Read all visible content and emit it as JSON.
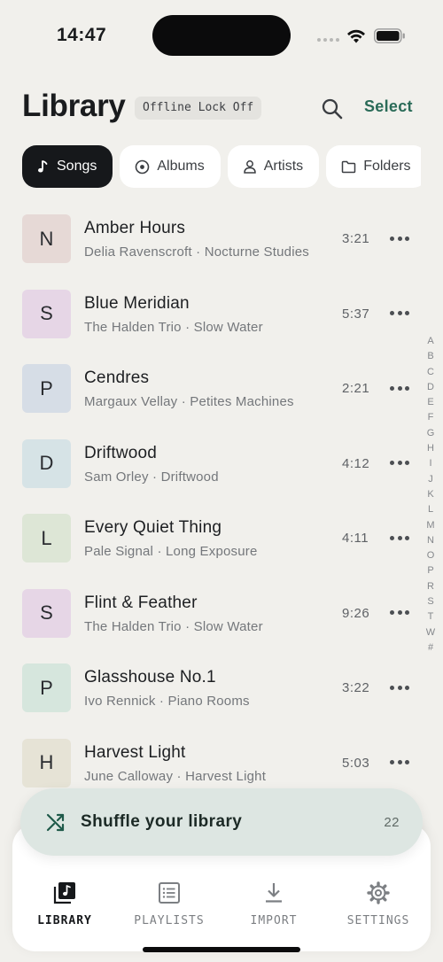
{
  "status_bar": {
    "time": "14:47"
  },
  "header": {
    "title": "Library",
    "badge": "Offline Lock Off",
    "select_label": "Select"
  },
  "filters": [
    {
      "label": "Songs",
      "icon": "music-note-icon",
      "active": true
    },
    {
      "label": "Albums",
      "icon": "disc-icon",
      "active": false
    },
    {
      "label": "Artists",
      "icon": "person-icon",
      "active": false
    },
    {
      "label": "Folders",
      "icon": "folder-icon",
      "active": false
    }
  ],
  "songs": [
    {
      "initial": "N",
      "title": "Amber Hours",
      "subtitle": "Delia Ravenscroft · Nocturne Studies",
      "duration": "3:21",
      "color": "#e6d9d6"
    },
    {
      "initial": "S",
      "title": "Blue Meridian",
      "subtitle": "The Halden Trio · Slow Water",
      "duration": "5:37",
      "color": "#e6d6e6"
    },
    {
      "initial": "P",
      "title": "Cendres",
      "subtitle": "Margaux Vellay · Petites Machines",
      "duration": "2:21",
      "color": "#d6dde6"
    },
    {
      "initial": "D",
      "title": "Driftwood",
      "subtitle": "Sam Orley · Driftwood",
      "duration": "4:12",
      "color": "#d6e3e6"
    },
    {
      "initial": "L",
      "title": "Every Quiet Thing",
      "subtitle": "Pale Signal · Long Exposure",
      "duration": "4:11",
      "color": "#dde6d6"
    },
    {
      "initial": "S",
      "title": "Flint & Feather",
      "subtitle": "The Halden Trio · Slow Water",
      "duration": "9:26",
      "color": "#e6d6e6"
    },
    {
      "initial": "P",
      "title": "Glasshouse No.1",
      "subtitle": "Ivo Rennick · Piano Rooms",
      "duration": "3:22",
      "color": "#d6e6dd"
    },
    {
      "initial": "H",
      "title": "Harvest Light",
      "subtitle": "June Calloway · Harvest Light",
      "duration": "5:03",
      "color": "#e6e3d6"
    }
  ],
  "alphabet": [
    "A",
    "B",
    "C",
    "D",
    "E",
    "F",
    "G",
    "H",
    "I",
    "J",
    "K",
    "L",
    "M",
    "N",
    "O",
    "P",
    "R",
    "S",
    "T",
    "W",
    "#"
  ],
  "shuffle": {
    "label": "Shuffle your library",
    "count": "22"
  },
  "nav": [
    {
      "label": "LIBRARY",
      "icon": "library-icon",
      "active": true
    },
    {
      "label": "PLAYLISTS",
      "icon": "playlist-icon",
      "active": false
    },
    {
      "label": "IMPORT",
      "icon": "download-icon",
      "active": false
    },
    {
      "label": "SETTINGS",
      "icon": "gear-icon",
      "active": false
    }
  ],
  "colors": {
    "accent": "#2a6b58",
    "background": "#f1f0ec",
    "active_chip": "#16181b",
    "shuffle_bg": "#dde6e2"
  }
}
